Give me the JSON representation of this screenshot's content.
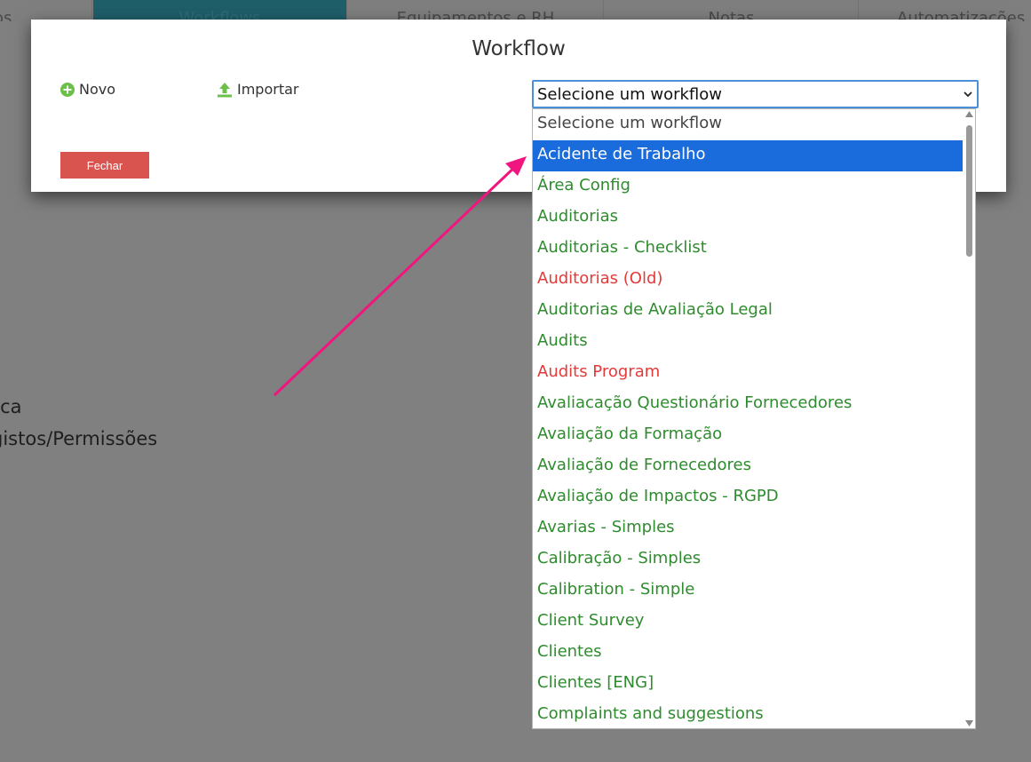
{
  "tabs": [
    {
      "label": "os"
    },
    {
      "label": "Workflows",
      "active": true
    },
    {
      "label": "Equipamentos e RH"
    },
    {
      "label": "Notas"
    },
    {
      "label": "Automatizações e"
    }
  ],
  "background_text": {
    "line1": "tica",
    "line2": "gistos/Permissões"
  },
  "modal": {
    "title": "Workflow",
    "novo_label": "Novo",
    "importar_label": "Importar",
    "fechar_label": "Fechar",
    "select_value": "Selecione um workflow"
  },
  "dropdown": {
    "options": [
      {
        "label": "Selecione um workflow",
        "color": "gray"
      },
      {
        "label": "Acidente de Trabalho",
        "color": "selected"
      },
      {
        "label": "Área Config",
        "color": "green"
      },
      {
        "label": "Auditorias",
        "color": "green"
      },
      {
        "label": "Auditorias - Checklist",
        "color": "green"
      },
      {
        "label": "Auditorias (Old)",
        "color": "red"
      },
      {
        "label": "Auditorias de Avaliação Legal",
        "color": "green"
      },
      {
        "label": "Audits",
        "color": "green"
      },
      {
        "label": "Audits Program",
        "color": "red"
      },
      {
        "label": "Avaliacação Questionário Fornecedores",
        "color": "green"
      },
      {
        "label": "Avaliação da Formação",
        "color": "green"
      },
      {
        "label": "Avaliação de Fornecedores",
        "color": "green"
      },
      {
        "label": "Avaliação de Impactos - RGPD",
        "color": "green"
      },
      {
        "label": "Avarias - Simples",
        "color": "green"
      },
      {
        "label": "Calibração - Simples",
        "color": "green"
      },
      {
        "label": "Calibration - Simple",
        "color": "green"
      },
      {
        "label": "Client Survey",
        "color": "green"
      },
      {
        "label": "Clientes",
        "color": "green"
      },
      {
        "label": "Clientes [ENG]",
        "color": "green"
      },
      {
        "label": "Complaints and suggestions",
        "color": "green"
      }
    ]
  },
  "colors": {
    "green": "#2e8b2e",
    "red": "#e33a3a",
    "selected_bg": "#1a6bdb",
    "fechar_bg": "#d9534f",
    "annotation_arrow": "#f0157f"
  }
}
